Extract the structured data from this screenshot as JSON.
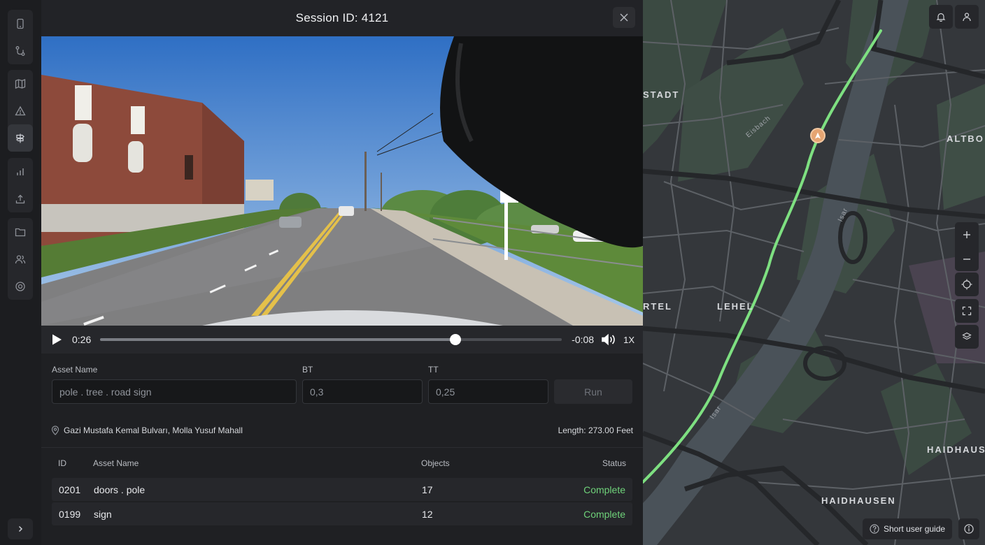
{
  "panel": {
    "title": "Session ID: 4121",
    "close_icon": "close-icon"
  },
  "sidebar": {
    "items": [
      {
        "icon": "tablet-icon"
      },
      {
        "icon": "route-icon"
      },
      {
        "icon": "map-icon"
      },
      {
        "icon": "warning-icon"
      },
      {
        "icon": "signpost-icon",
        "active": true
      },
      {
        "icon": "bar-chart-icon"
      },
      {
        "icon": "upload-icon"
      },
      {
        "icon": "folder-icon"
      },
      {
        "icon": "users-icon"
      },
      {
        "icon": "settings-icon"
      }
    ],
    "expand_icon": "chevron-right-icon"
  },
  "player": {
    "current_time": "0:26",
    "remaining_time": "-0:08",
    "speed": "1X",
    "progress": 0.77
  },
  "form": {
    "asset_label": "Asset Name",
    "asset_placeholder": "pole . tree . road sign",
    "bt_label": "BT",
    "bt_placeholder": "0,3",
    "tt_label": "TT",
    "tt_placeholder": "0,25",
    "run_label": "Run"
  },
  "location": {
    "address": "Gazi Mustafa Kemal Bulvarı, Molla Yusuf Mahall",
    "length": "Length: 273.00 Feet"
  },
  "table": {
    "headers": {
      "id": "ID",
      "asset": "Asset Name",
      "objects": "Objects",
      "status": "Status"
    },
    "rows": [
      {
        "id": "0201",
        "asset": "doors . pole",
        "objects": "17",
        "status": "Complete"
      },
      {
        "id": "0199",
        "asset": "sign",
        "objects": "12",
        "status": "Complete"
      }
    ]
  },
  "map": {
    "labels": {
      "stadt": "STADT",
      "altbo": "ALTBO",
      "lehel": "LEHEL",
      "rtel": "RTEL",
      "haidhaus": "HAIDHAUS",
      "haidhausen": "HAIDHAUSEN",
      "eisbach": "Eisbach",
      "isar1": "Isar",
      "isar2": "Isar"
    },
    "guide_label": "Short user guide",
    "route_color": "#7ee081",
    "marker_color": "#e6a572"
  }
}
